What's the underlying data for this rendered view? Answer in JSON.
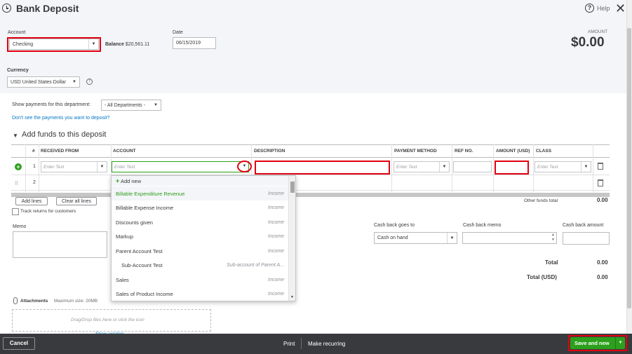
{
  "header": {
    "title": "Bank Deposit",
    "help_label": "Help",
    "amount_label": "AMOUNT",
    "amount_value": "$0.00"
  },
  "account": {
    "label": "Account",
    "value": "Checking",
    "balance_label": "Balance",
    "balance_value": "$20,561.11"
  },
  "date": {
    "label": "Date",
    "value": "06/15/2019"
  },
  "currency": {
    "label": "Currency",
    "value": "USD United States Dollar"
  },
  "department": {
    "label": "Show payments for this department:",
    "value": "- All Departments -",
    "link": "Don't see the payments you want to deposit?"
  },
  "section": {
    "title": "Add funds to this deposit"
  },
  "table": {
    "columns": [
      "#",
      "RECEIVED FROM",
      "ACCOUNT",
      "DESCRIPTION",
      "PAYMENT METHOD",
      "REF NO.",
      "AMOUNT (USD)",
      "CLASS"
    ],
    "row1_num": "1",
    "row2_num": "2",
    "placeholder": "Enter Text",
    "add_lines": "Add lines",
    "clear_lines": "Clear all lines",
    "track_returns": "Track returns for customers",
    "other_total_label": "Other funds total",
    "other_total_value": "0.00"
  },
  "dropdown": {
    "add_new": "Add new",
    "items": [
      {
        "name": "Billable Expenditure Revenue",
        "type": "Income"
      },
      {
        "name": "Billable Expense Income",
        "type": "Income"
      },
      {
        "name": "Discounts given",
        "type": "Income"
      },
      {
        "name": "Markup",
        "type": "Income"
      },
      {
        "name": "Parent Account Test",
        "type": "Income"
      },
      {
        "name": "Sub-Account Test",
        "type": "Sub-account of Parent A..."
      },
      {
        "name": "Sales",
        "type": "Income"
      },
      {
        "name": "Sales of Product Income",
        "type": "Income"
      }
    ]
  },
  "memo": {
    "label": "Memo"
  },
  "cashback": {
    "goes_to_label": "Cash back goes to",
    "goes_to_value": "Cash on hand",
    "memo_label": "Cash back memo",
    "amount_label": "Cash back amount"
  },
  "totals": {
    "total_label": "Total",
    "total_value": "0.00",
    "total_usd_label": "Total (USD)",
    "total_usd_value": "0.00"
  },
  "attachments": {
    "label": "Attachments",
    "max_size": "Maximum size: 20MB",
    "drop_text": "Drag/Drop files here or click the icon",
    "show_existing": "Show existing"
  },
  "footer": {
    "cancel": "Cancel",
    "print": "Print",
    "make_recurring": "Make recurring",
    "save_new": "Save and new"
  },
  "colors": {
    "green": "#2ca01c",
    "red_highlight": "#e1000f",
    "footer_bg": "#393a3d"
  }
}
